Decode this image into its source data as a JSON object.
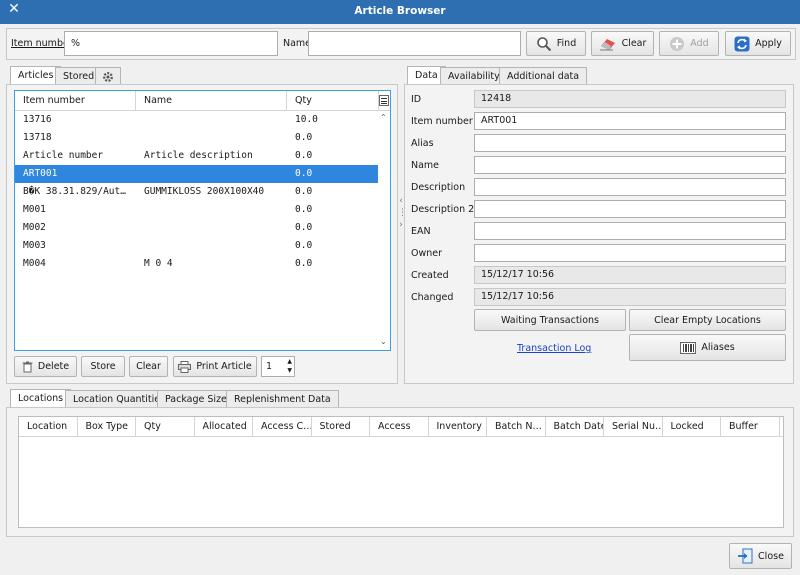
{
  "window": {
    "title": "Article Browser",
    "close_glyph": "✕"
  },
  "search": {
    "item_number_label": "Item number",
    "item_number_value": "%",
    "name_label": "Name",
    "name_value": ""
  },
  "toolbar": {
    "find": "Find",
    "clear": "Clear",
    "add": "Add",
    "apply": "Apply"
  },
  "left_tabs": [
    "Articles",
    "Stored"
  ],
  "list": {
    "headers": [
      "Item number",
      "Name",
      "Qty"
    ],
    "rows": [
      {
        "item": "13716",
        "name": "",
        "qty": "10.0"
      },
      {
        "item": "13718",
        "name": "",
        "qty": "0.0"
      },
      {
        "item": "Article number",
        "name": "Article description",
        "qty": "0.0"
      },
      {
        "item": "ART001",
        "name": "",
        "qty": "0.0",
        "selected": true
      },
      {
        "item": "B�K 38.31.829/Aut…",
        "name": "GUMMIKLOSS 200X100X40",
        "qty": "0.0"
      },
      {
        "item": "M001",
        "name": "",
        "qty": "0.0"
      },
      {
        "item": "M002",
        "name": "",
        "qty": "0.0"
      },
      {
        "item": "M003",
        "name": "",
        "qty": "0.0"
      },
      {
        "item": "M004",
        "name": "M 0 4",
        "qty": "0.0"
      }
    ]
  },
  "list_buttons": {
    "delete": "Delete",
    "store": "Store",
    "clear": "Clear",
    "print": "Print Article",
    "copies": "1"
  },
  "right_tabs": [
    "Data",
    "Availability",
    "Additional data"
  ],
  "details": {
    "fields": [
      {
        "label": "ID",
        "value": "12418",
        "readonly": true
      },
      {
        "label": "Item number",
        "value": "ART001",
        "readonly": false
      },
      {
        "label": "Alias",
        "value": "",
        "readonly": false
      },
      {
        "label": "Name",
        "value": "",
        "readonly": false
      },
      {
        "label": "Description",
        "value": "",
        "readonly": false
      },
      {
        "label": "Description 2",
        "value": "",
        "readonly": false
      },
      {
        "label": "EAN",
        "value": "",
        "readonly": false
      },
      {
        "label": "Owner",
        "value": "",
        "readonly": false
      },
      {
        "label": "Created",
        "value": "15/12/17 10:56",
        "readonly": true
      },
      {
        "label": "Changed",
        "value": "15/12/17 10:56",
        "readonly": true
      }
    ],
    "waiting_transactions": "Waiting Transactions",
    "clear_empty_locations": "Clear Empty Locations",
    "transaction_log": "Transaction Log",
    "aliases": "Aliases"
  },
  "bottom_tabs": [
    "Locations",
    "Location Quantities",
    "Package Sizes",
    "Replenishment Data"
  ],
  "locations_headers": [
    "Location",
    "Box Type",
    "Qty",
    "Allocated",
    "Access C…",
    "Stored",
    "Access",
    "Inventory",
    "Batch N…",
    "Batch Date",
    "Serial Nu…",
    "Locked",
    "Buffer"
  ],
  "footer": {
    "close": "Close"
  },
  "colors": {
    "titlebar": "#2d6fb1",
    "selection": "#2e86de",
    "focus_border": "#3aa0e0",
    "link": "#1d43c9"
  }
}
